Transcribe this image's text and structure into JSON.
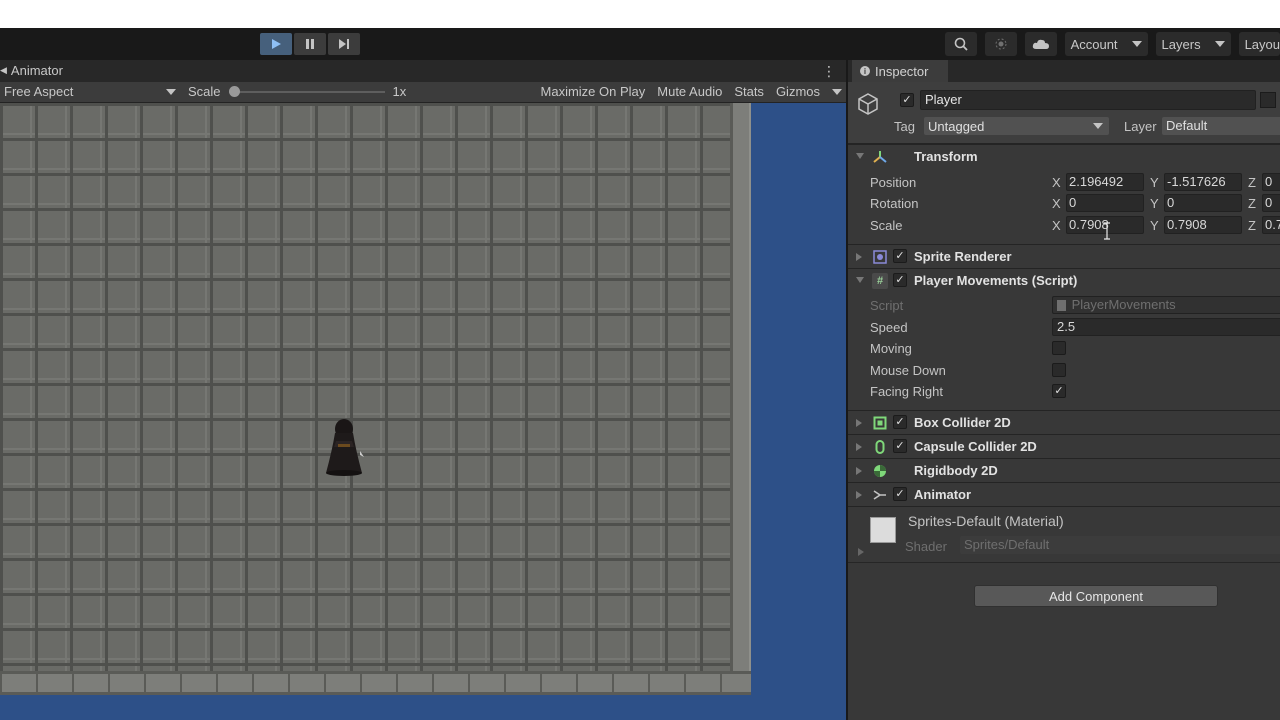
{
  "toolbar": {
    "play_icon": "play-icon",
    "pause_icon": "pause-icon",
    "step_icon": "step-icon",
    "search_icon": "search-icon",
    "collab_icon": "collab-icon",
    "cloud_icon": "cloud-icon",
    "account_label": "Account",
    "layers_label": "Layers",
    "layout_label": "Layou",
    "accent": "#46607c"
  },
  "game_view": {
    "tab_label": "Animator",
    "aspect_label": "Free Aspect",
    "scale_label": "Scale",
    "scale_value": "1x",
    "scale_slider": 0.0,
    "buttons": [
      "Maximize On Play",
      "Mute Audio",
      "Stats",
      "Gizmos"
    ],
    "background_color": "#2d5088"
  },
  "inspector": {
    "tab_label": "Inspector",
    "object_name": "Player",
    "tag_label": "Tag",
    "tag_value": "Untagged",
    "layer_label": "Layer",
    "layer_value": "Default",
    "transform": {
      "title": "Transform",
      "position_label": "Position",
      "rotation_label": "Rotation",
      "scale_label": "Scale",
      "axis_x": "X",
      "axis_y": "Y",
      "axis_z": "Z",
      "position": {
        "x": "2.196492",
        "y": "-1.517626",
        "z": "0"
      },
      "rotation": {
        "x": "0",
        "y": "0",
        "z": "0"
      },
      "scale": {
        "x": "0.7908",
        "y": "0.7908",
        "z": "0.7"
      }
    },
    "sprite_renderer": {
      "title": "Sprite Renderer"
    },
    "player_movements": {
      "title": "Player Movements (Script)",
      "script_label": "Script",
      "script_value": "PlayerMovements",
      "speed_label": "Speed",
      "speed_value": "2.5",
      "moving_label": "Moving",
      "mouse_down_label": "Mouse Down",
      "facing_right_label": "Facing Right",
      "facing_right_check": "✓"
    },
    "box_collider": {
      "title": "Box Collider 2D"
    },
    "capsule_collider": {
      "title": "Capsule Collider 2D"
    },
    "rigidbody": {
      "title": "Rigidbody 2D"
    },
    "animator": {
      "title": "Animator"
    },
    "material": {
      "name": "Sprites-Default (Material)",
      "shader_label": "Shader",
      "shader_value": "Sprites/Default"
    },
    "add_component_label": "Add Component",
    "check_mark": "✓"
  }
}
